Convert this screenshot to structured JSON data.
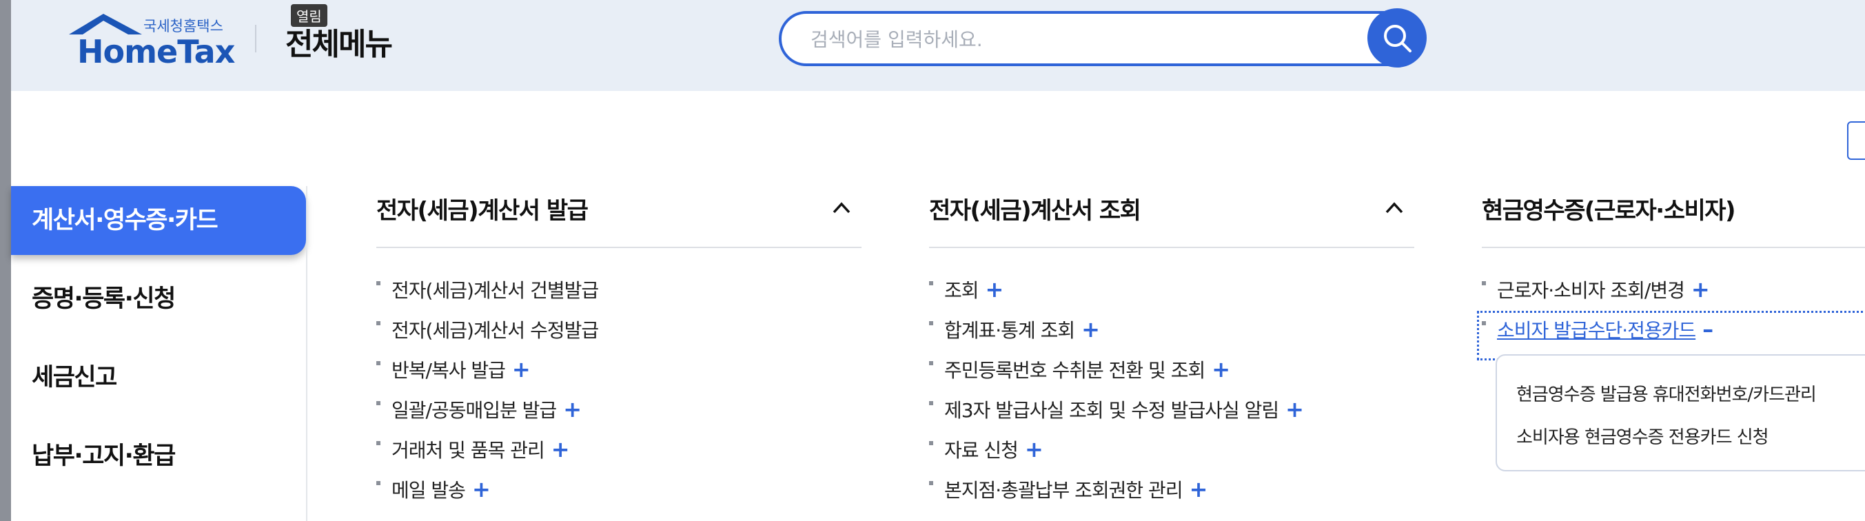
{
  "header": {
    "logo_sub": "국세청홈택스",
    "logo_main": "HomeTax",
    "page_title": "전체메뉴",
    "tooltip": "열림"
  },
  "search": {
    "placeholder": "검색어를 입력하세요."
  },
  "sidebar": {
    "items": [
      {
        "label": "계산서·영수증·카드",
        "active": true
      },
      {
        "label": "증명·등록·신청"
      },
      {
        "label": "세금신고"
      },
      {
        "label": "납부·고지·환급"
      }
    ]
  },
  "columns": [
    {
      "title": "전자(세금)계산서 발급",
      "items": [
        {
          "label": "전자(세금)계산서 건별발급",
          "expand": ""
        },
        {
          "label": "전자(세금)계산서 수정발급",
          "expand": ""
        },
        {
          "label": "반복/복사 발급",
          "expand": "+"
        },
        {
          "label": "일괄/공동매입분 발급",
          "expand": "+"
        },
        {
          "label": "거래처 및 품목 관리",
          "expand": "+"
        },
        {
          "label": "메일 발송",
          "expand": "+"
        }
      ]
    },
    {
      "title": "전자(세금)계산서 조회",
      "items": [
        {
          "label": "조회",
          "expand": "+"
        },
        {
          "label": "합계표·통계 조회",
          "expand": "+"
        },
        {
          "label": "주민등록번호 수취분 전환 및 조회",
          "expand": "+"
        },
        {
          "label": "제3자 발급사실 조회 및 수정 발급사실 알림",
          "expand": "+"
        },
        {
          "label": "자료 신청",
          "expand": "+"
        },
        {
          "label": "본지점·총괄납부 조회권한 관리",
          "expand": "+"
        }
      ]
    },
    {
      "title": "현금영수증(근로자·소비자)",
      "items": [
        {
          "label": "근로자·소비자 조회/변경",
          "expand": "+"
        },
        {
          "label": "소비자 발급수단·전용카드",
          "expand": "–"
        }
      ],
      "subitems": [
        {
          "label": "현금영수증 발급용 휴대전화번호/카드관리"
        },
        {
          "label": "소비자용 현금영수증 전용카드 신청"
        }
      ]
    }
  ],
  "colors": {
    "accent": "#2f64d8",
    "active_bg": "#3a6ff0",
    "header_bg": "#e8eef6"
  }
}
